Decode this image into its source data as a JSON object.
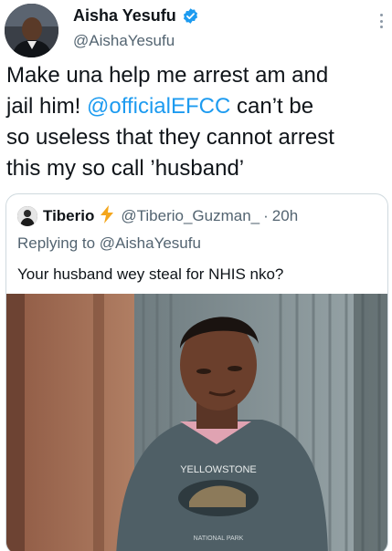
{
  "tweet": {
    "author": {
      "name": "Aisha Yesufu",
      "handle": "@AishaYesufu"
    },
    "text_lines": [
      {
        "before": "Make una help me arrest am and",
        "mention": "",
        "after": ""
      },
      {
        "before": "jail him! ",
        "mention": "@officialEFCC",
        "after": " can’t be"
      },
      {
        "before": "so useless that they cannot arrest",
        "mention": "",
        "after": ""
      },
      {
        "before": "this my so call ’husband’",
        "mention": "",
        "after": ""
      }
    ]
  },
  "quoted_tweet": {
    "author": {
      "name": "Tiberio",
      "handle": "@Tiberio_Guzman_"
    },
    "separator": "·",
    "time": "20h",
    "replying_prefix": "Replying to",
    "replying_to": "@AishaYesufu",
    "text": "Your husband wey steal for NHIS nko?",
    "media": {
      "shirt_text_top": "YELLOWSTONE",
      "shirt_text_bottom": "NATIONAL PARK"
    }
  },
  "colors": {
    "accent": "#1d9bf0",
    "verified": "#1d9bf0",
    "bolt": "#f4a61c",
    "muted": "#536471"
  },
  "icons": [
    "verified-badge-icon",
    "more-options-icon",
    "lightning-bolt-icon"
  ]
}
